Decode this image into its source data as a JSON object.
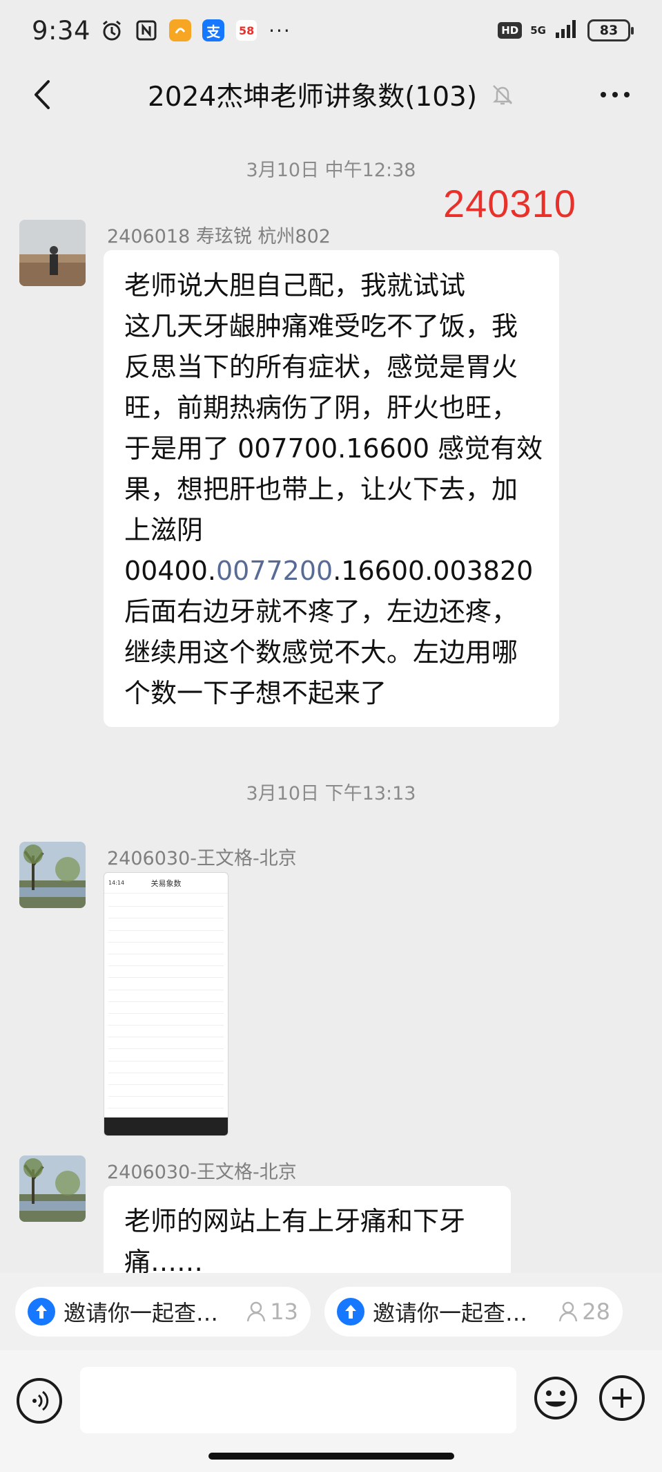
{
  "status_bar": {
    "time": "9:34",
    "network": "5G",
    "hd": "HD",
    "battery": "83",
    "more": "···",
    "app_badge_58": "58"
  },
  "header": {
    "title": "2024杰坤老师讲象数(103)"
  },
  "messages": {
    "ts1": "3月10日 中午12:38",
    "stamp": "240310",
    "m1_sender": "2406018   寿玹锐   杭州802",
    "m1_lines": [
      "老师说大胆自己配，我就试试",
      "这几天牙龈肿痛难受吃不了饭，我",
      "反思当下的所有症状，感觉是胃火",
      "旺，前期热病伤了阴，肝火也旺，",
      "于是用了 007700.16600 感觉有效",
      "果，想把肝也带上，让火下去，加",
      "上滋阴"
    ],
    "m1_line8_pre": "00400.",
    "m1_line8_link": "0077200",
    "m1_line8_post": ".16600.003820",
    "m1_lines_after": [
      "后面右边牙就不疼了，左边还疼，",
      "继续用这个数感觉不大。左边用哪",
      "个数一下子想不起来了"
    ],
    "ts2": "3月10日 下午13:13",
    "m2_sender": "2406030-王文格-北京",
    "m2_image_title": "关易象数",
    "m2_image_time": "14:14",
    "m3_sender": "2406030-王文格-北京",
    "m3_lines": [
      "老师的网站上有上牙痛和下牙",
      "痛……"
    ]
  },
  "invites": [
    {
      "label": "邀请你一起查…",
      "count": "13"
    },
    {
      "label": "邀请你一起查…",
      "count": "28"
    }
  ],
  "colors": {
    "link": "#576b95",
    "stamp": "#e8312a",
    "invite_icon": "#1677ff"
  }
}
